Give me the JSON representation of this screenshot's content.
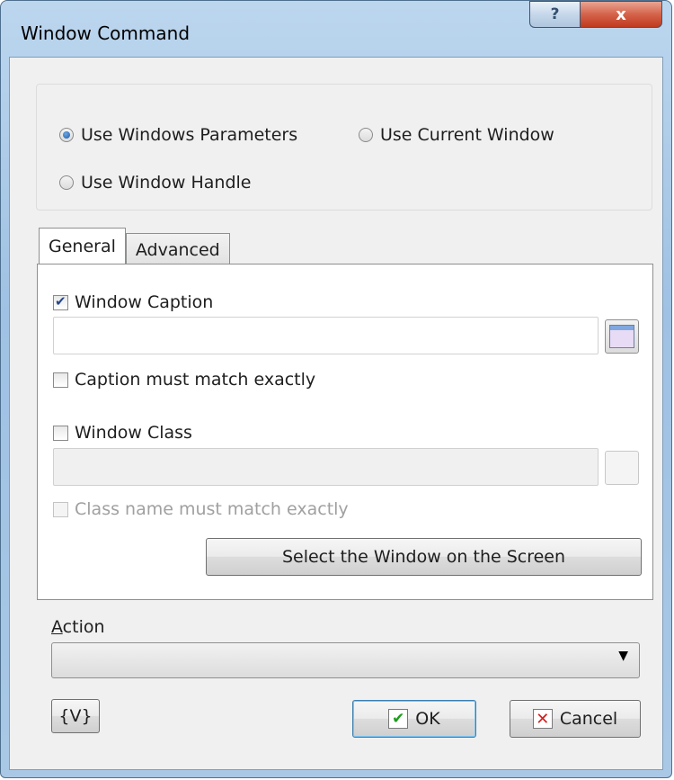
{
  "window": {
    "title": "Window Command",
    "help_glyph": "?",
    "close_glyph": "x"
  },
  "mode": {
    "options": [
      {
        "label": "Use Windows Parameters",
        "selected": true
      },
      {
        "label": "Use Current Window",
        "selected": false
      },
      {
        "label": "Use Window Handle",
        "selected": false
      }
    ]
  },
  "tabs": [
    {
      "label": "General",
      "active": true
    },
    {
      "label": "Advanced",
      "active": false
    }
  ],
  "general": {
    "window_caption": {
      "label": "Window Caption",
      "checked": true,
      "value": ""
    },
    "caption_exact": {
      "label": "Caption must match exactly",
      "checked": false
    },
    "window_class": {
      "label": "Window Class",
      "checked": false,
      "value": ""
    },
    "class_exact": {
      "label": "Class name must match exactly",
      "checked": false,
      "disabled": true
    },
    "select_button": "Select the Window on the Screen"
  },
  "action": {
    "label": "Action",
    "value": ""
  },
  "buttons": {
    "variables": "{V}",
    "ok": "OK",
    "cancel": "Cancel"
  },
  "icons": {
    "select_window": "window-picker-icon",
    "ok": "checkmark-icon",
    "cancel": "red-x-icon",
    "dropdown": "chevron-down-icon"
  }
}
